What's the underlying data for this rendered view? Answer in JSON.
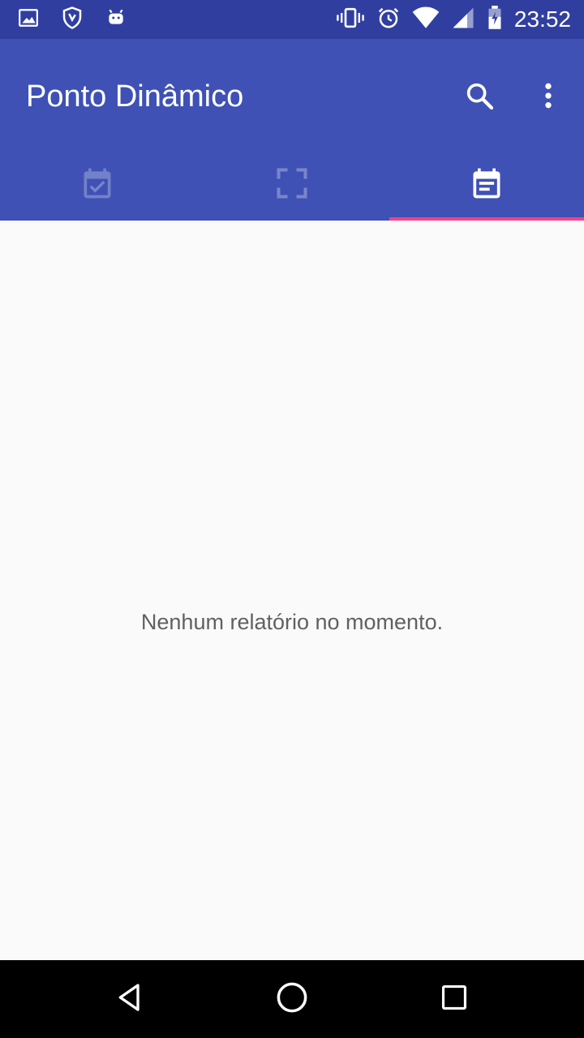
{
  "status_bar": {
    "time": "23:52",
    "left_icons": [
      "image-icon",
      "shield-notification-icon",
      "android-icon"
    ],
    "right_icons": [
      "vibrate-icon",
      "alarm-icon",
      "wifi-icon",
      "signal-icon",
      "battery-charging-icon"
    ]
  },
  "app_bar": {
    "title": "Ponto Dinâmico",
    "actions": [
      "search-icon",
      "more-vert-icon"
    ]
  },
  "tabs": [
    {
      "icon": "calendar-check-icon",
      "selected": false
    },
    {
      "icon": "scan-frame-icon",
      "selected": false
    },
    {
      "icon": "calendar-report-icon",
      "selected": true
    }
  ],
  "content": {
    "empty_message": "Nenhum relatório no momento."
  },
  "nav_bar": {
    "buttons": [
      "back-icon",
      "home-icon",
      "recents-icon"
    ]
  },
  "colors": {
    "primary": "#3f51b5",
    "primary_dark": "#303f9f",
    "accent": "#ff4081",
    "background": "#fafafa",
    "text_secondary": "#616161"
  }
}
